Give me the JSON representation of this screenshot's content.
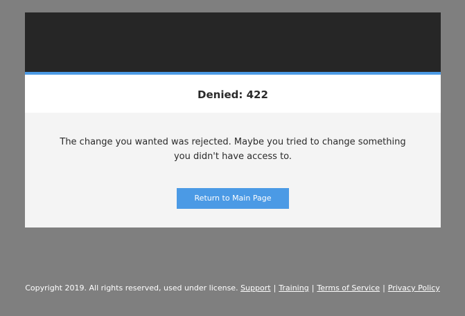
{
  "dialog": {
    "title": "Denied: 422",
    "message": "The change you wanted was rejected. Maybe you tried to change something you didn't have access to.",
    "button_label": "Return to Main Page"
  },
  "footer": {
    "copyright": "Copyright 2019. All rights reserved, used under license.",
    "separator": "|",
    "links": {
      "support": "Support",
      "training": "Training",
      "terms": "Terms of Service",
      "privacy": "Privacy Policy"
    }
  },
  "colors": {
    "page_background": "#7f7f7f",
    "header_bar": "#262626",
    "accent": "#4b9ae5",
    "dialog_body": "#f4f4f4"
  }
}
